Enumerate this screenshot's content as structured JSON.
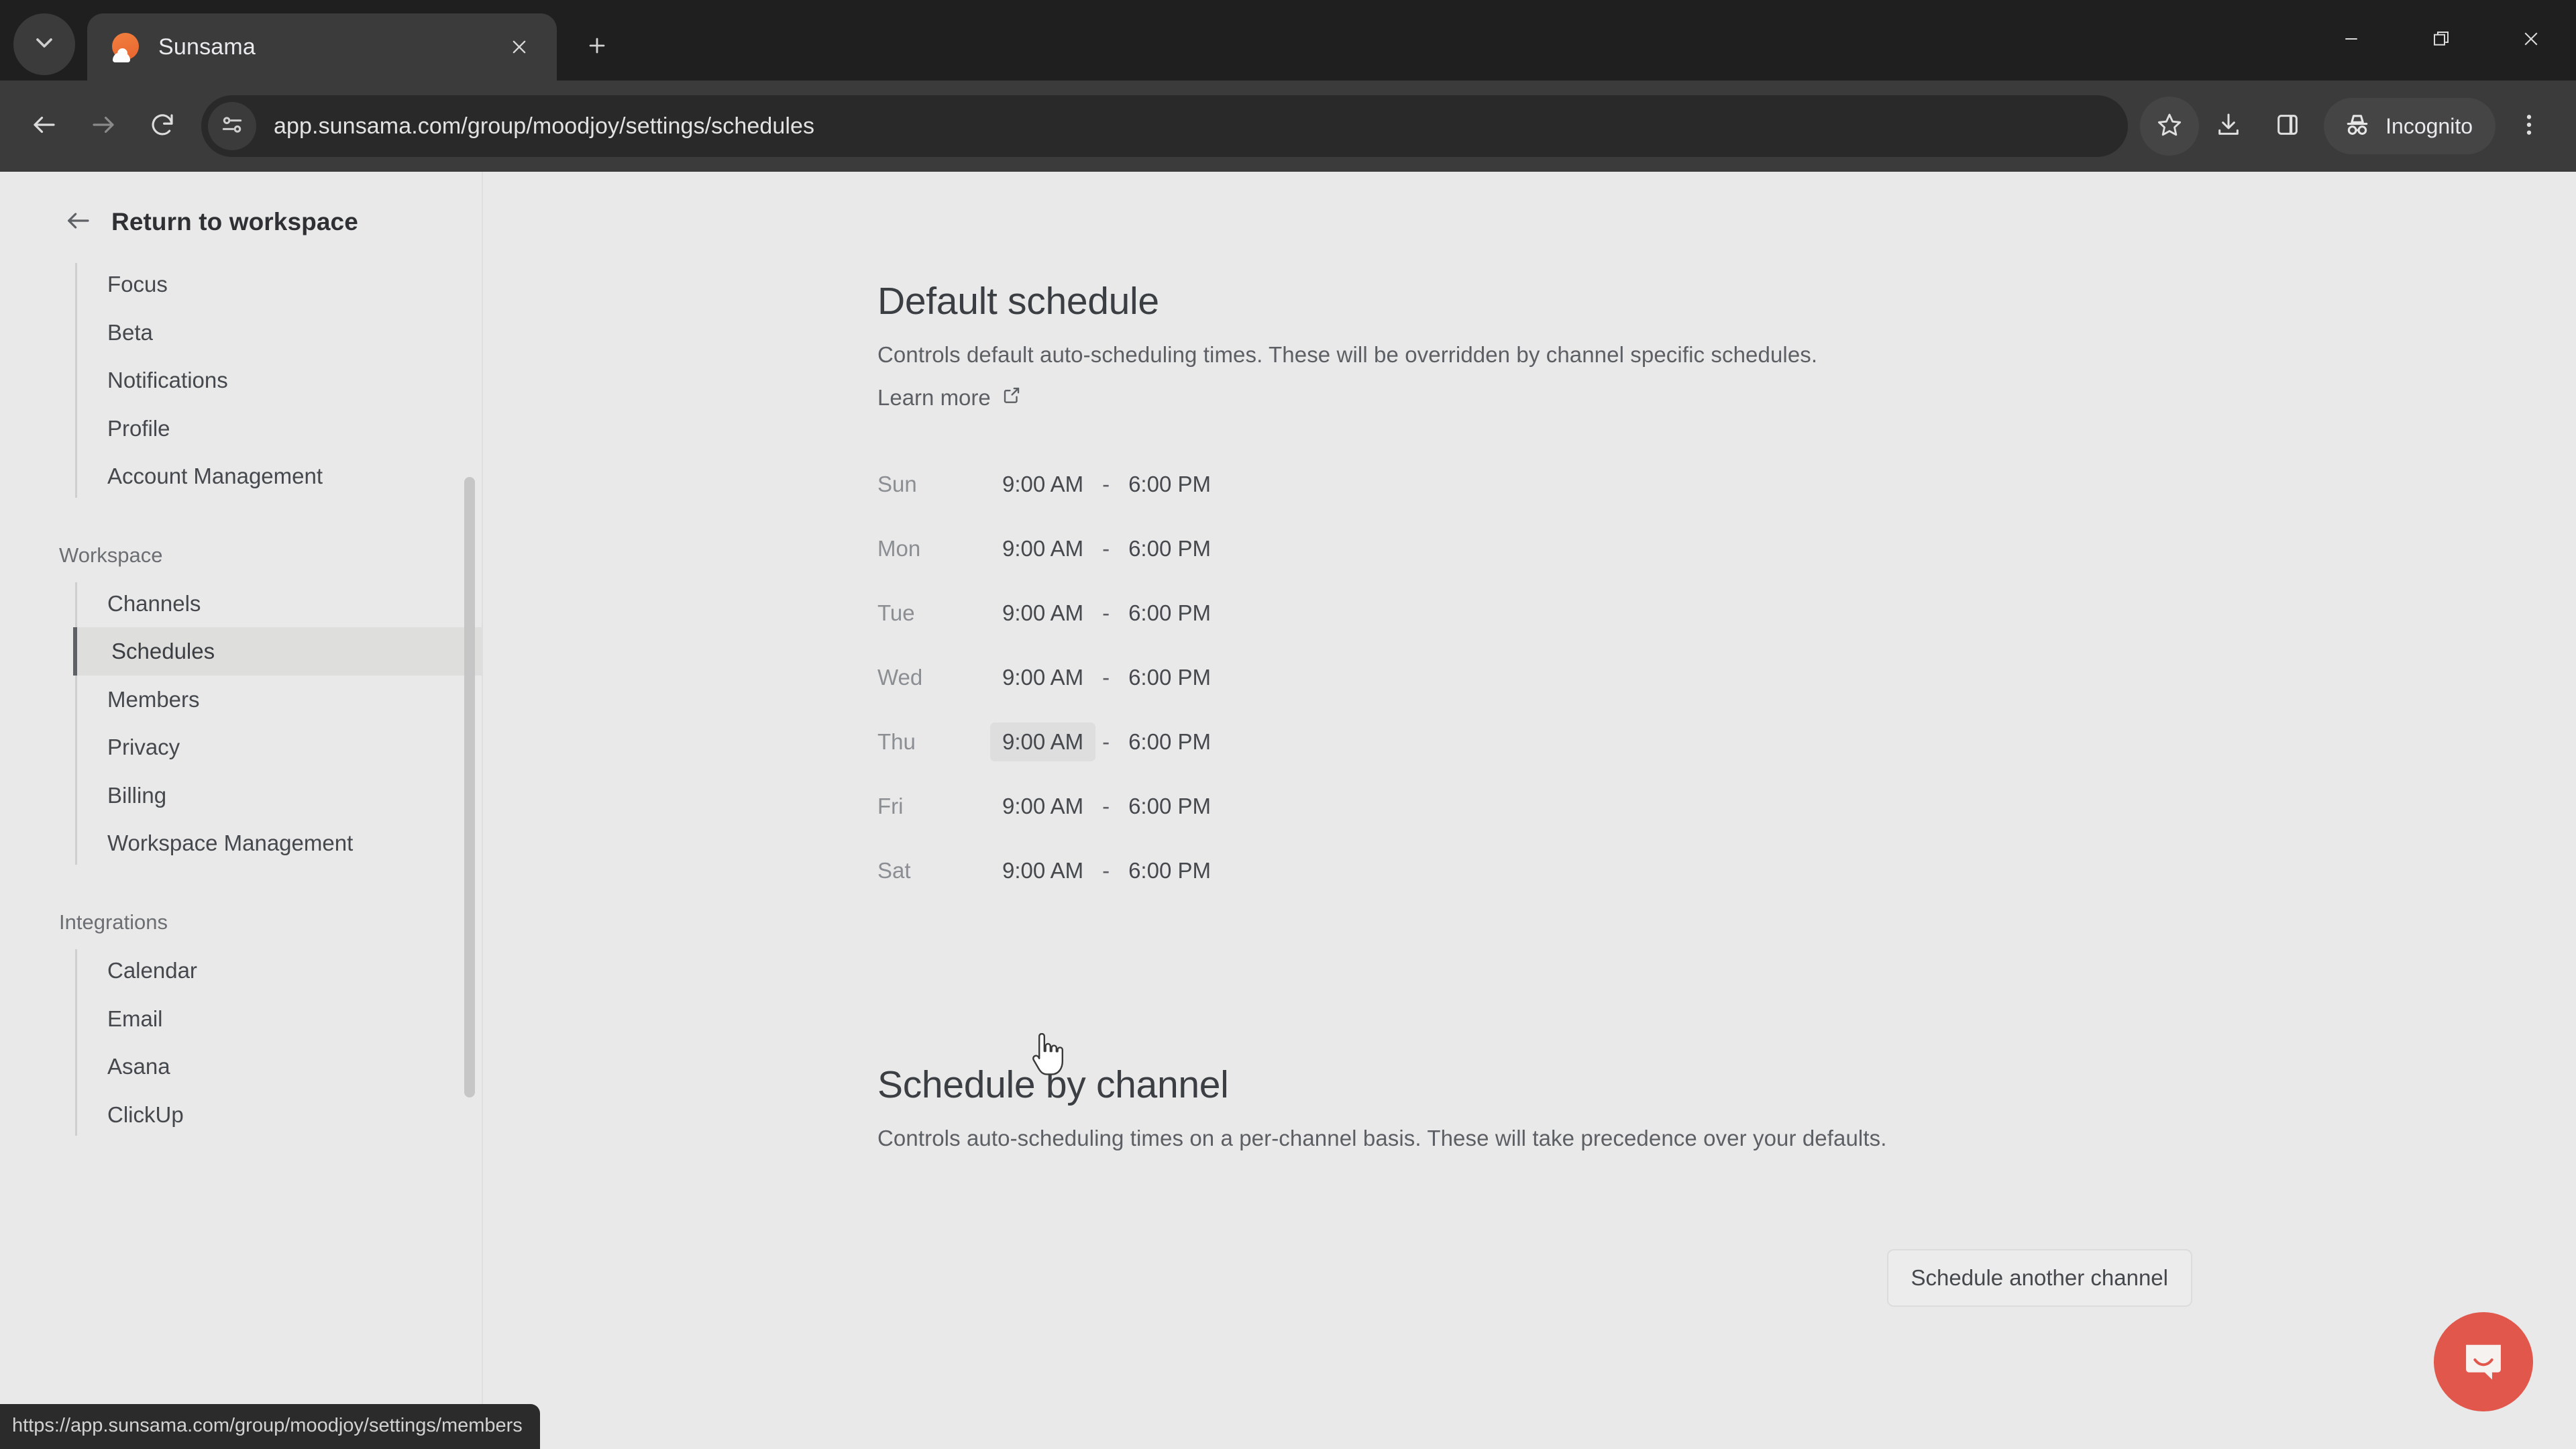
{
  "browser": {
    "tab_search_icon": "chevron-down-icon",
    "tab": {
      "title": "Sunsama",
      "favicon": "sunsama-sun-cloud-icon",
      "close_icon": "close-icon"
    },
    "new_tab_icon": "plus-icon",
    "window_controls": {
      "minimize": "minimize-icon",
      "maximize": "restore-icon",
      "close": "close-icon"
    },
    "toolbar": {
      "back_icon": "arrow-left-icon",
      "forward_icon": "arrow-right-icon",
      "reload_icon": "reload-icon",
      "site_info_icon": "tune-sliders-icon",
      "url": "app.sunsama.com/group/moodjoy/settings/schedules",
      "bookmark_icon": "star-icon",
      "downloads_icon": "download-icon",
      "side_panel_icon": "side-panel-icon",
      "incognito_icon": "incognito-hat-icon",
      "incognito_label": "Incognito",
      "menu_icon": "kebab-menu-icon"
    }
  },
  "status_bar": {
    "url": "https://app.sunsama.com/group/moodjoy/settings/members"
  },
  "sidebar": {
    "back_icon": "arrow-left-icon",
    "header": "Return to workspace",
    "groups": [
      {
        "label": "",
        "items": [
          {
            "label": "Focus",
            "active": false
          },
          {
            "label": "Beta",
            "active": false
          },
          {
            "label": "Notifications",
            "active": false
          },
          {
            "label": "Profile",
            "active": false
          },
          {
            "label": "Account Management",
            "active": false
          }
        ]
      },
      {
        "label": "Workspace",
        "items": [
          {
            "label": "Channels",
            "active": false
          },
          {
            "label": "Schedules",
            "active": true
          },
          {
            "label": "Members",
            "active": false
          },
          {
            "label": "Privacy",
            "active": false
          },
          {
            "label": "Billing",
            "active": false
          },
          {
            "label": "Workspace Management",
            "active": false
          }
        ]
      },
      {
        "label": "Integrations",
        "items": [
          {
            "label": "Calendar",
            "active": false
          },
          {
            "label": "Email",
            "active": false
          },
          {
            "label": "Asana",
            "active": false
          },
          {
            "label": "ClickUp",
            "active": false
          }
        ]
      }
    ]
  },
  "main": {
    "default_schedule": {
      "title": "Default schedule",
      "description": "Controls default auto-scheduling times. These will be overridden by channel specific schedules.",
      "learn_more": "Learn more",
      "learn_more_icon": "external-link-icon",
      "separator": "-",
      "rows": [
        {
          "day": "Sun",
          "start": "9:00 AM",
          "end": "6:00 PM",
          "start_hovered": false
        },
        {
          "day": "Mon",
          "start": "9:00 AM",
          "end": "6:00 PM",
          "start_hovered": false
        },
        {
          "day": "Tue",
          "start": "9:00 AM",
          "end": "6:00 PM",
          "start_hovered": false
        },
        {
          "day": "Wed",
          "start": "9:00 AM",
          "end": "6:00 PM",
          "start_hovered": false
        },
        {
          "day": "Thu",
          "start": "9:00 AM",
          "end": "6:00 PM",
          "start_hovered": true
        },
        {
          "day": "Fri",
          "start": "9:00 AM",
          "end": "6:00 PM",
          "start_hovered": false
        },
        {
          "day": "Sat",
          "start": "9:00 AM",
          "end": "6:00 PM",
          "start_hovered": false
        }
      ]
    },
    "schedule_by_channel": {
      "title": "Schedule by channel",
      "description": "Controls auto-scheduling times on a per-channel basis. These will take precedence over your defaults.",
      "button": "Schedule another channel"
    }
  },
  "intercom": {
    "icon": "intercom-messenger-icon",
    "color": "#e2574c"
  },
  "colors": {
    "page_bg": "#e9e9e9",
    "chrome_bg": "#3b3b3b",
    "tabstrip_bg": "#1f1f1f",
    "active_nav_bg": "#dededd",
    "accent": "#e2574c"
  }
}
